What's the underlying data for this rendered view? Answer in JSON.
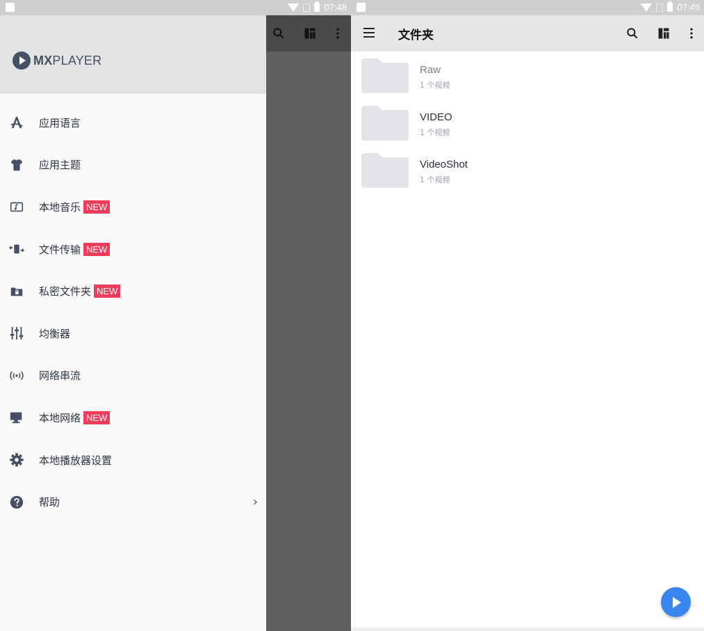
{
  "left_screen": {
    "status": {
      "time": "07:48"
    },
    "brand": {
      "logo_bold": "MX",
      "logo_rest": "PLAYER"
    },
    "menu": [
      {
        "label": "应用语言",
        "icon": "language-icon"
      },
      {
        "label": "应用主题",
        "icon": "tshirt-icon"
      },
      {
        "label": "本地音乐",
        "icon": "music-folder-icon",
        "badge": "NEW"
      },
      {
        "label": "文件传输",
        "icon": "transfer-icon",
        "badge": "NEW"
      },
      {
        "label": "私密文件夹",
        "icon": "locked-folder-icon",
        "badge": "NEW"
      },
      {
        "label": "均衡器",
        "icon": "equalizer-icon"
      },
      {
        "label": "网络串流",
        "icon": "stream-icon"
      },
      {
        "label": "本地网络",
        "icon": "monitor-icon",
        "badge": "NEW"
      },
      {
        "label": "本地播放器设置",
        "icon": "gear-icon"
      },
      {
        "label": "帮助",
        "icon": "help-icon",
        "chevron": "›"
      }
    ]
  },
  "right_screen": {
    "status": {
      "time": "07:49"
    },
    "toolbar": {
      "title": "文件夹"
    },
    "folders": [
      {
        "name": "Raw",
        "count": "1 个视频",
        "dim": true
      },
      {
        "name": "VIDEO",
        "count": "1 个视频"
      },
      {
        "name": "VideoShot",
        "count": "1 个视频"
      }
    ]
  },
  "colors": {
    "accent": "#3a86f0",
    "badge": "#f03c5b",
    "icon": "#455066",
    "header": "#e3e3e3",
    "scrim": "#5f5f5f"
  }
}
